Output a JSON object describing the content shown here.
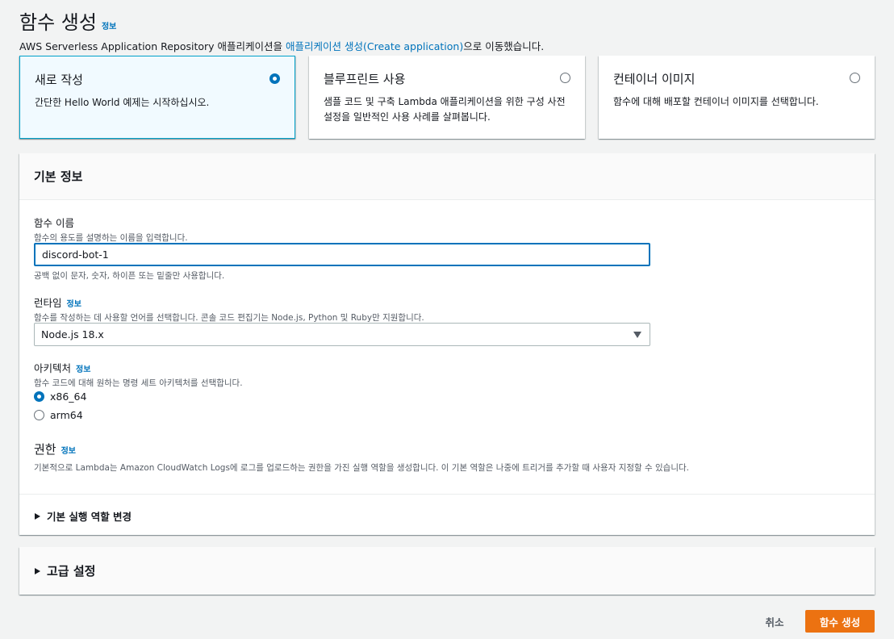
{
  "header": {
    "title": "함수 생성",
    "info": "정보",
    "subtitle_prefix": "AWS Serverless Application Repository 애플리케이션을 ",
    "subtitle_link": "애플리케이션 생성(Create application)",
    "subtitle_suffix": "으로 이동했습니다."
  },
  "options": [
    {
      "title": "새로 작성",
      "desc": "간단한 Hello World 예제는 시작하십시오.",
      "selected": true
    },
    {
      "title": "블루프린트 사용",
      "desc": "샘플 코드 및 구축 Lambda 애플리케이션을 위한 구성 사전 설정을 일반적인 사용 사례를 살펴봅니다.",
      "selected": false
    },
    {
      "title": "컨테이너 이미지",
      "desc": "함수에 대해 배포할 컨테이너 이미지를 선택합니다.",
      "selected": false
    }
  ],
  "basic_info": {
    "heading": "기본 정보",
    "function_name": {
      "label": "함수 이름",
      "desc": "함수의 용도를 설명하는 이름을 입력합니다.",
      "value": "discord-bot-1",
      "constraint": "공백 없이 문자, 숫자, 하이픈 또는 밑줄만 사용합니다."
    },
    "runtime": {
      "label": "런타임",
      "info": "정보",
      "desc": "함수를 작성하는 데 사용할 언어를 선택합니다. 콘솔 코드 편집기는 Node.js, Python 및 Ruby만 지원합니다.",
      "selected": "Node.js 18.x"
    },
    "architecture": {
      "label": "아키텍처",
      "info": "정보",
      "desc": "함수 코드에 대해 원하는 명령 세트 아키텍처를 선택합니다.",
      "options": [
        {
          "label": "x86_64",
          "checked": true
        },
        {
          "label": "arm64",
          "checked": false
        }
      ]
    },
    "permissions": {
      "title": "권한",
      "info": "정보",
      "desc": "기본적으로 Lambda는 Amazon CloudWatch Logs에 로그를 업로드하는 권한을 가진 실행 역할을 생성합니다. 이 기본 역할은 나중에 트리거를 추가할 때 사용자 지정할 수 있습니다."
    },
    "role_expander": "기본 실행 역할 변경"
  },
  "advanced": {
    "label": "고급 설정"
  },
  "footer": {
    "cancel": "취소",
    "create": "함수 생성"
  }
}
